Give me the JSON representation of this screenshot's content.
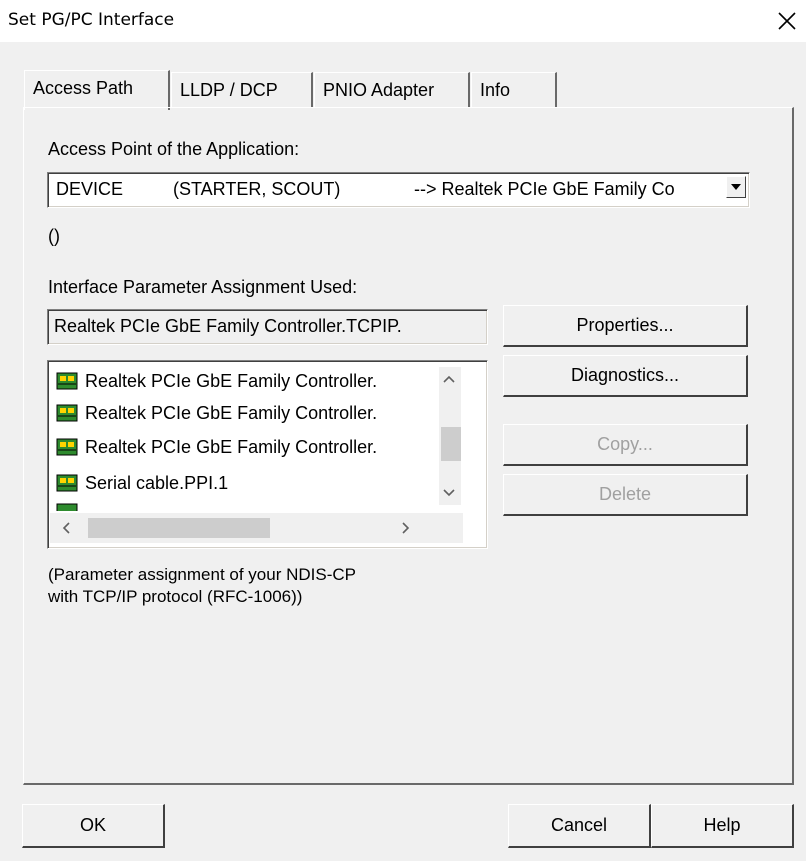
{
  "window": {
    "title": "Set PG/PC Interface"
  },
  "tabs": [
    {
      "label": "Access Path"
    },
    {
      "label": "LLDP / DCP"
    },
    {
      "label": "PNIO Adapter"
    },
    {
      "label": "Info"
    }
  ],
  "access_point": {
    "label": "Access Point of the Application:",
    "col_device": "DEVICE",
    "col_app": "(STARTER, SCOUT)",
    "col_target": "--> Realtek PCIe GbE Family Co",
    "note": "()"
  },
  "interface_param": {
    "label": "Interface Parameter Assignment Used:",
    "value": "Realtek PCIe GbE Family Controller.TCPIP."
  },
  "interface_list": {
    "items": [
      "Realtek PCIe GbE Family Controller.",
      "Realtek PCIe GbE Family Controller.",
      "Realtek PCIe GbE Family Controller.",
      "Serial cable.PPI.1"
    ]
  },
  "buttons": {
    "properties": "Properties...",
    "diagnostics": "Diagnostics...",
    "copy": "Copy...",
    "delete": "Delete",
    "ok": "OK",
    "cancel": "Cancel",
    "help": "Help"
  },
  "description": {
    "line1": "(Parameter assignment of your NDIS-CP",
    "line2": "with TCP/IP protocol (RFC-1006))"
  }
}
